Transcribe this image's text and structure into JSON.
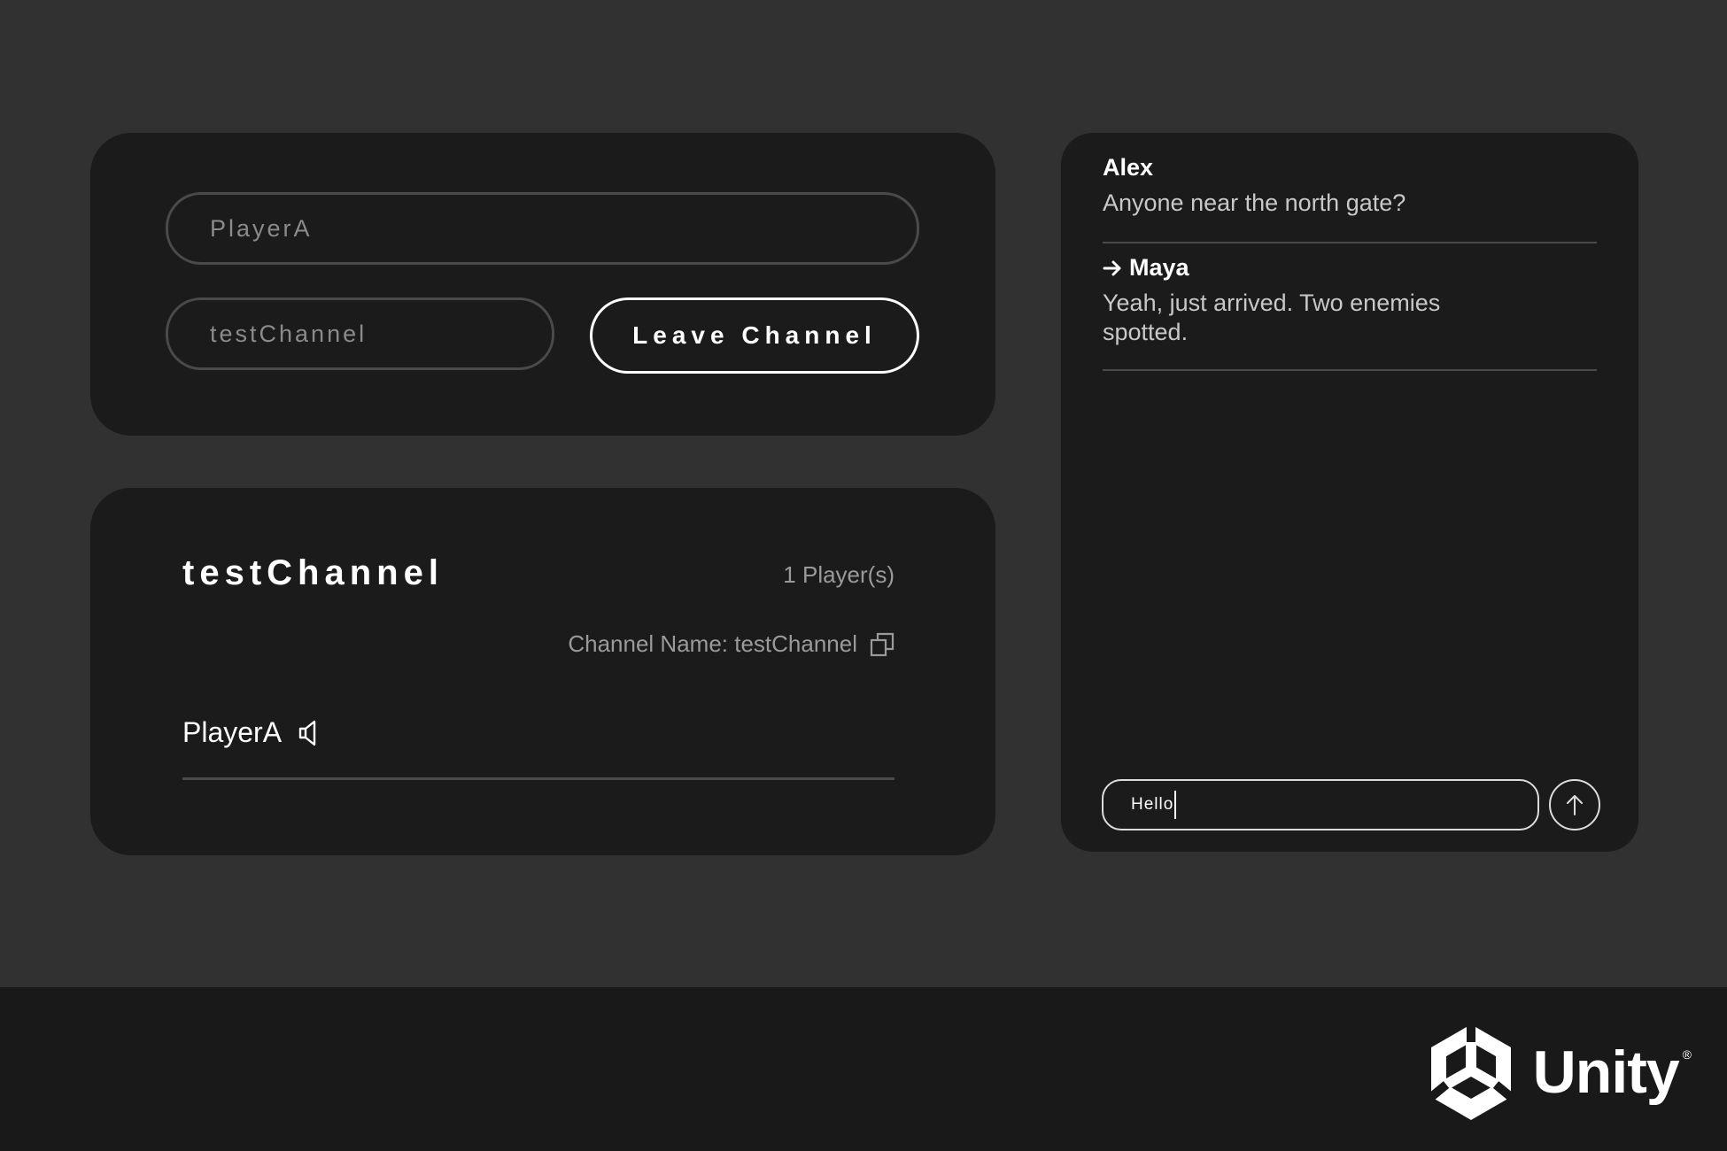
{
  "join_panel": {
    "player_name_value": "PlayerA",
    "channel_name_value": "testChannel",
    "leave_button_label": "Leave Channel"
  },
  "channel_panel": {
    "title": "testChannel",
    "player_count": "1 Player(s)",
    "channel_name_label": "Channel Name: testChannel",
    "players": [
      {
        "name": "PlayerA",
        "icon": "speaker-icon"
      }
    ]
  },
  "chat": {
    "messages": [
      {
        "author": "Alex",
        "text": "Anyone near the north gate?",
        "outgoing": false
      },
      {
        "author": "Maya",
        "text": "Yeah, just arrived. Two enemies spotted.",
        "outgoing": true
      }
    ],
    "input_value": "Hello",
    "send_icon": "arrow-up-icon"
  },
  "footer": {
    "logo_text": "Unity",
    "registered_mark": "®"
  },
  "colors": {
    "background": "#313131",
    "card": "#1b1b1b",
    "footer": "#191919",
    "muted_text": "#9a9a9a",
    "border": "#4a4a4a",
    "accent": "#ffffff"
  }
}
